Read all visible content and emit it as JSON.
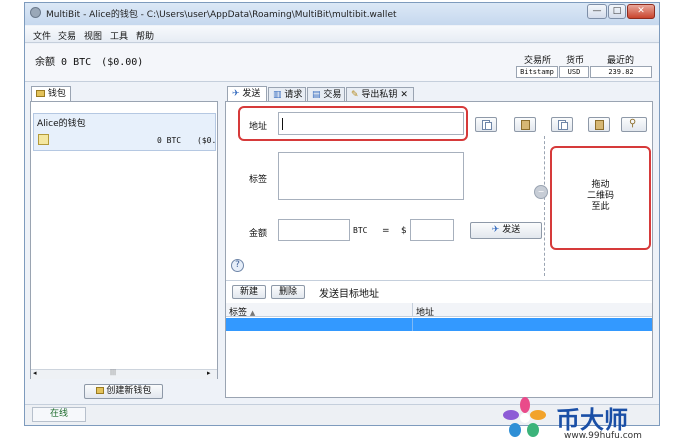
{
  "window": {
    "title": "MultiBit - Alice的钱包 - C:\\Users\\user\\AppData\\Roaming\\MultiBit\\multibit.wallet",
    "minimize": "—",
    "maximize": "□",
    "close": "✕"
  },
  "menu": [
    "文件",
    "交易",
    "视图",
    "工具",
    "帮助"
  ],
  "balance": {
    "label": "余额",
    "amount": "0 BTC",
    "fiat": "($0.00)"
  },
  "exchange": {
    "headers": [
      "交易所",
      "货币",
      "最近的"
    ],
    "values": [
      "Bitstamp",
      "USD",
      "239.82"
    ]
  },
  "wallets": {
    "tab": "钱包",
    "items": [
      {
        "name": "Alice的钱包",
        "balance": "0 BTC",
        "fiat": "($0."
      }
    ],
    "create_button": "创建新钱包"
  },
  "tabs": [
    "发送",
    "请求",
    "交易",
    "导出私钥"
  ],
  "send": {
    "address_label": "地址",
    "address_value": "",
    "label_label": "标签",
    "amount_label": "金额",
    "currency": "BTC",
    "equals": "=",
    "fiat_symbol": "$",
    "send_button": "发送",
    "help": "?",
    "qr_lines": [
      "拖动",
      "二维码",
      "至此"
    ]
  },
  "addressbook": {
    "new_button": "新建",
    "delete_button": "删除",
    "title": "发送目标地址",
    "columns": [
      "标签",
      "地址"
    ]
  },
  "status": {
    "text": "在线"
  },
  "watermark": {
    "brand": "币大师",
    "url": "www.99hufu.com"
  },
  "colors": {
    "highlight_red": "#d63a3a",
    "selection": "#3399ff",
    "window_frame": "#7e9bbd"
  },
  "icons": [
    "multibit-icon",
    "wallet-icon",
    "send-icon",
    "request-icon",
    "transactions-icon",
    "export-key-icon",
    "copy-icon",
    "paste-icon",
    "zoom-icon",
    "help-icon",
    "create-wallet-icon"
  ]
}
